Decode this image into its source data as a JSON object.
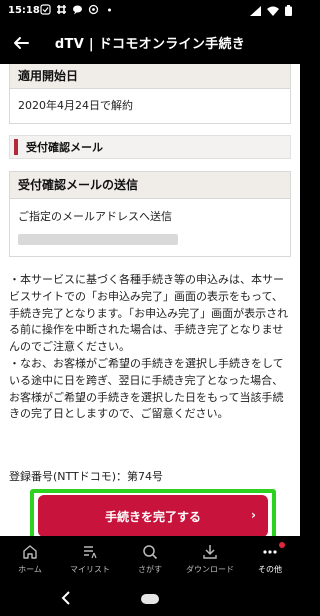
{
  "status_bar": {
    "time": "15:18",
    "icons": [
      "notification-icon",
      "slack-icon",
      "chat-icon",
      "sync-icon",
      "dot-icon",
      "signal-icon",
      "wifi-icon",
      "battery-icon"
    ]
  },
  "app_bar": {
    "title": "dTV | ドコモオンライン手続き"
  },
  "start_date_section": {
    "heading": "適用開始日",
    "value": "2020年4月24日で解約"
  },
  "confirmation_mail_bar": {
    "label": "受付確認メール"
  },
  "mail_send_section": {
    "heading": "受付確認メールの送信",
    "text": "ご指定のメールアドレスへ送信"
  },
  "notes": [
    "・本サービスに基づく各種手続き等の申込みは、本サービスサイトでの「お申込み完了」画面の表示をもって、手続き完了となります。「お申込み完了」画面が表示される前に操作を中断された場合は、手続き完了となりませんのでご注意ください。",
    "・なお、お客様がご希望の手続きを選択し手続きをしている途中に日を跨ぎ、翌日に手続き完了となった場合、お客様がご希望の手続きを選択した日をもって当該手続きの完了日としますので、ご留意ください。"
  ],
  "registration": {
    "text": "登録番号(NTTドコモ)：第74号"
  },
  "cta": {
    "label": "手続きを完了する",
    "chevron": "›"
  },
  "bottom_nav": {
    "items": [
      {
        "label": "ホーム",
        "icon": "home-icon"
      },
      {
        "label": "マイリスト",
        "icon": "mylist-icon"
      },
      {
        "label": "さがす",
        "icon": "search-icon"
      },
      {
        "label": "ダウンロード",
        "icon": "download-icon"
      },
      {
        "label": "その他",
        "icon": "more-icon"
      }
    ],
    "active_index": 4
  },
  "colors": {
    "accent": "#c8143c",
    "highlight": "#2dd11f",
    "bar_accent": "#b02a3c"
  }
}
